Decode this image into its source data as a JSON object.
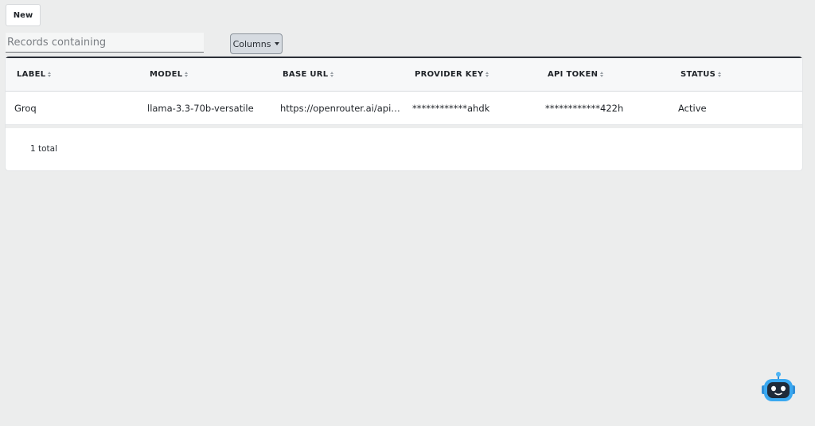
{
  "toolbar": {
    "new_label": "New",
    "search_placeholder": "Records containing",
    "search_value": "",
    "columns_label": "Columns"
  },
  "table": {
    "headers": [
      "LABEL",
      "MODEL",
      "BASE URL",
      "PROVIDER KEY",
      "API TOKEN",
      "STATUS"
    ],
    "rows": [
      [
        "Groq",
        "llama-3.3-70b-versatile",
        "https://openrouter.ai/api…",
        "************ahdk",
        "************422h",
        "Active"
      ]
    ]
  },
  "footer": {
    "total_text": "1 total"
  },
  "assistant": {
    "icon": "robot-icon"
  },
  "colors": {
    "accent": "#2b2f36",
    "bot_primary": "#3aa8f0",
    "background": "#eceded"
  }
}
